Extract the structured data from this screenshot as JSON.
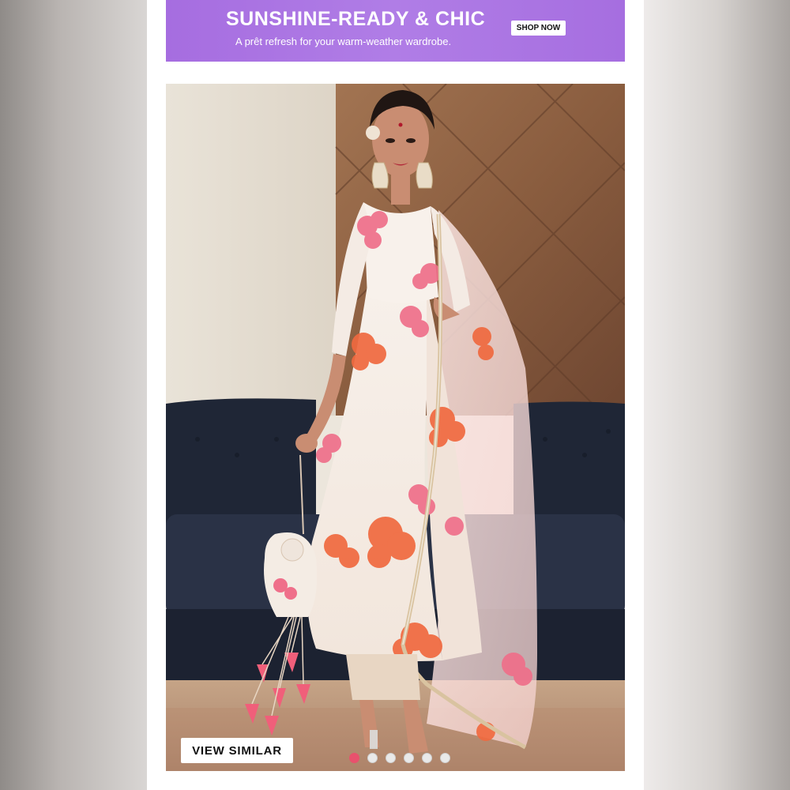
{
  "promo": {
    "title": "SUNSHINE-READY & CHIC",
    "subtitle": "A prêt refresh for your warm-weather wardrobe.",
    "cta_label": "SHOP NOW",
    "bg_color": "#a66de0"
  },
  "product": {
    "view_similar_label": "VIEW SIMILAR",
    "carousel": {
      "total_slides": 6,
      "active_index": 0,
      "active_color": "#e8516d"
    }
  }
}
